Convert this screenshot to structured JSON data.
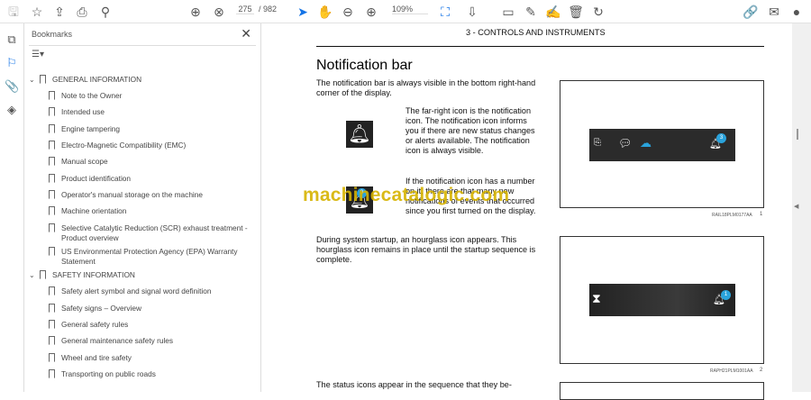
{
  "toolbar": {
    "page_current": "275",
    "page_total": "/ 982",
    "zoom": "109%"
  },
  "bookmarks": {
    "title": "Bookmarks",
    "items": [
      {
        "label": "GENERAL INFORMATION",
        "level": 0
      },
      {
        "label": "Note to the Owner",
        "level": 1
      },
      {
        "label": "Intended use",
        "level": 1
      },
      {
        "label": "Engine tampering",
        "level": 1
      },
      {
        "label": "Electro-Magnetic Compatibility (EMC)",
        "level": 1
      },
      {
        "label": "Manual scope",
        "level": 1
      },
      {
        "label": "Product identification",
        "level": 1
      },
      {
        "label": "Operator's manual storage on the machine",
        "level": 1
      },
      {
        "label": "Machine orientation",
        "level": 1
      },
      {
        "label": "Selective Catalytic Reduction (SCR) exhaust treatment - Product overview",
        "level": 1
      },
      {
        "label": "US Environmental Protection Agency (EPA) Warranty Statement",
        "level": 1
      },
      {
        "label": "SAFETY INFORMATION",
        "level": 0
      },
      {
        "label": "Safety alert symbol and signal word definition",
        "level": 1
      },
      {
        "label": "Safety signs  – Overview",
        "level": 1
      },
      {
        "label": "General safety rules",
        "level": 1
      },
      {
        "label": "General maintenance safety rules",
        "level": 1
      },
      {
        "label": "Wheel and tire safety",
        "level": 1
      },
      {
        "label": "Transporting on public roads",
        "level": 1
      }
    ]
  },
  "document": {
    "header": "3 - CONTROLS AND INSTRUMENTS",
    "title": "Notification bar",
    "para1": "The notification bar is always visible in the bottom right-hand corner of the display.",
    "para2": "The far-right icon is the notification icon.  The notification icon informs you if there are new status changes or alerts available.  The notification icon is always visible.",
    "para3": "If the notification icon has a number on it, there are that many new notifications of events that occurred since you first turned on the display.",
    "para4": "During system startup, an hourglass icon appears.  This hourglass icon remains in place until the startup sequence is complete.",
    "para5": "The status icons appear in the sequence that they be-",
    "fig1_caption": "RAIL18PLM0177AA",
    "fig1_num": "1",
    "fig2_caption": "RAPH21PLM1001AA",
    "fig2_num": "2",
    "badge1": "3",
    "badge2": "1",
    "badge3": "3"
  },
  "watermark": "machinecatalogic.com"
}
